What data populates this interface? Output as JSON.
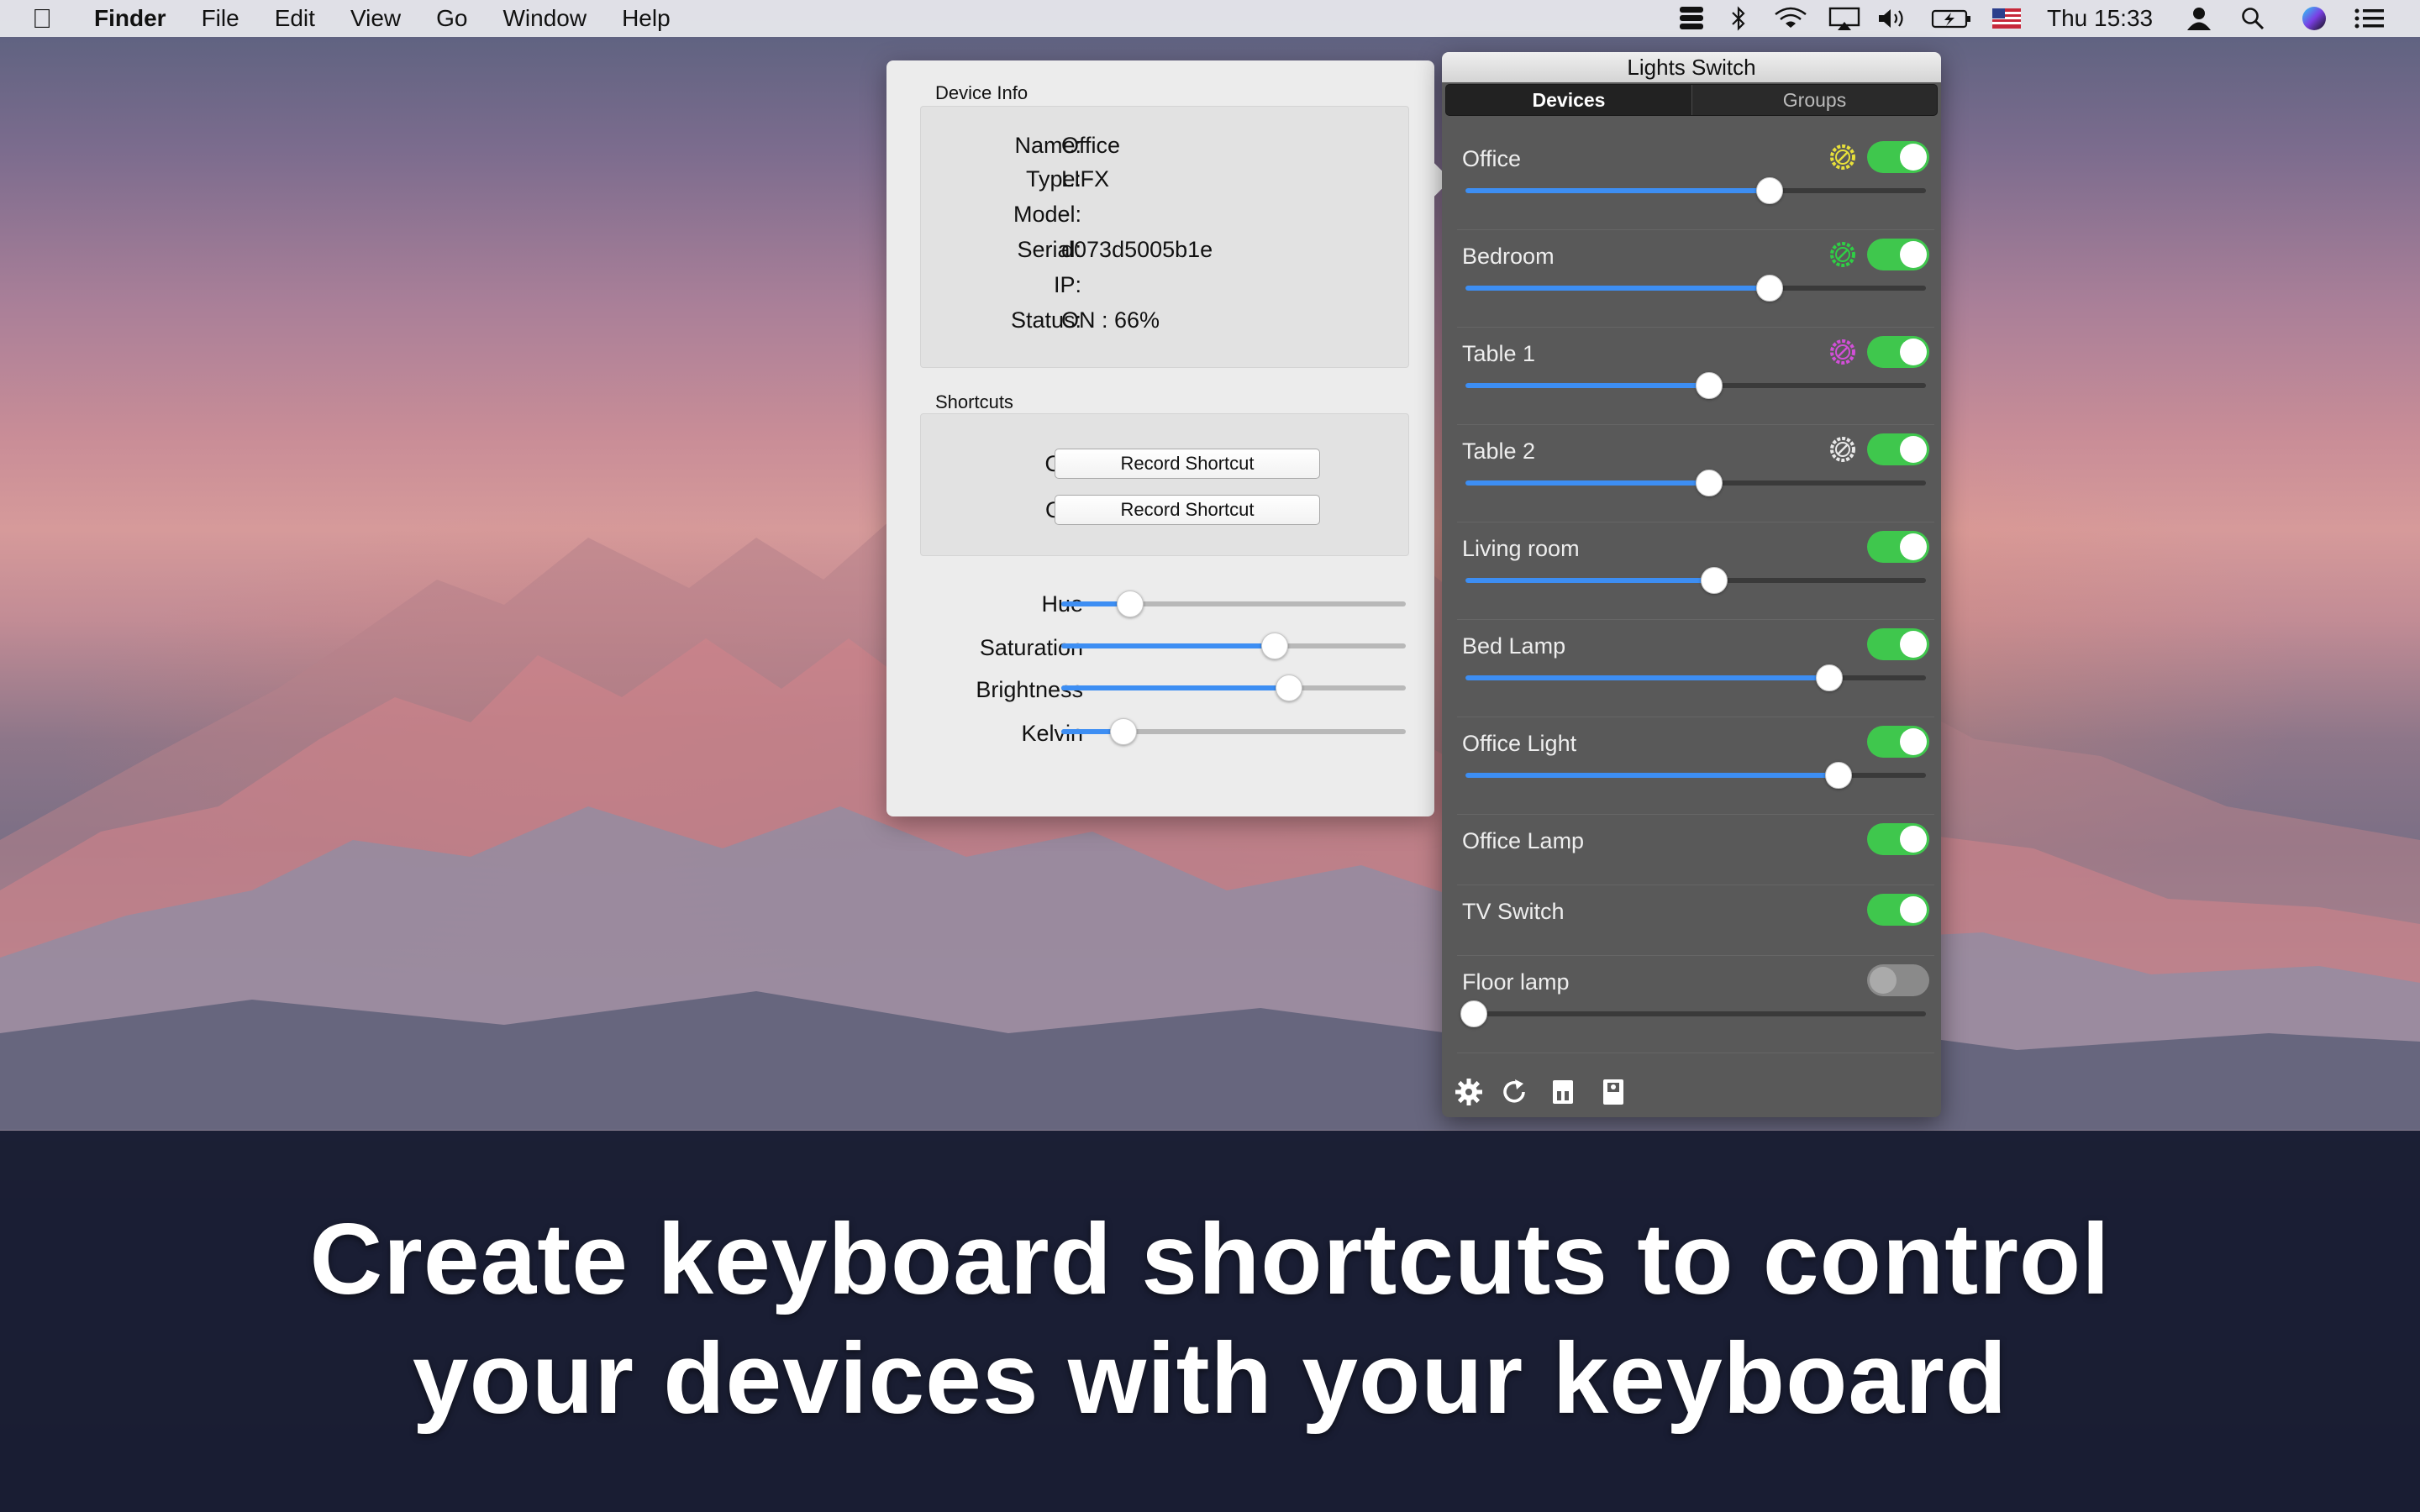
{
  "menubar": {
    "apple_icon": "apple-icon",
    "app_name": "Finder",
    "items": [
      "File",
      "Edit",
      "View",
      "Go",
      "Window",
      "Help"
    ],
    "clock": "Thu 15:33",
    "status_icons": [
      "lights-switch-icon",
      "bluetooth-icon",
      "wifi-icon",
      "airplay-icon",
      "volume-icon",
      "battery-icon",
      "flag-us-icon",
      "user-icon",
      "search-icon",
      "siri-icon",
      "notification-list-icon"
    ]
  },
  "device_info": {
    "title": "Device Info",
    "rows": [
      {
        "label": "Name:",
        "value": "Office"
      },
      {
        "label": "Type:",
        "value": "LIFX"
      },
      {
        "label": "Model:",
        "value": ""
      },
      {
        "label": "Serial:",
        "value": "d073d5005b1e"
      },
      {
        "label": "IP:",
        "value": ""
      },
      {
        "label": "Status:",
        "value": "ON : 66%"
      }
    ]
  },
  "shortcuts": {
    "title": "Shortcuts",
    "on_label": "On:",
    "off_label": "Off:",
    "on_button": "Record Shortcut",
    "off_button": "Record Shortcut"
  },
  "color_controls": [
    {
      "label": "Hue",
      "value": 0.2
    },
    {
      "label": "Saturation",
      "value": 0.62
    },
    {
      "label": "Brightness",
      "value": 0.66
    },
    {
      "label": "Kelvin",
      "value": 0.18
    }
  ],
  "panel": {
    "title": "Lights Switch",
    "tabs": [
      "Devices",
      "Groups"
    ],
    "active_tab": "Devices",
    "devices": [
      {
        "name": "Office",
        "on": true,
        "color": "#e8e03a",
        "level": 0.66,
        "has_slider": true
      },
      {
        "name": "Bedroom",
        "on": true,
        "color": "#2fcf45",
        "level": 0.66,
        "has_slider": true
      },
      {
        "name": "Table 1",
        "on": true,
        "color": "#d24fd8",
        "level": 0.53,
        "has_slider": true
      },
      {
        "name": "Table 2",
        "on": true,
        "color": "#e8e8e8",
        "level": 0.53,
        "has_slider": true
      },
      {
        "name": "Living room",
        "on": true,
        "color": "",
        "level": 0.54,
        "has_slider": true
      },
      {
        "name": "Bed Lamp",
        "on": true,
        "color": "",
        "level": 0.79,
        "has_slider": true
      },
      {
        "name": "Office Light",
        "on": true,
        "color": "",
        "level": 0.81,
        "has_slider": true
      },
      {
        "name": "Office Lamp",
        "on": true,
        "color": "",
        "level": null,
        "has_slider": false
      },
      {
        "name": "TV Switch",
        "on": true,
        "color": "",
        "level": null,
        "has_slider": false
      },
      {
        "name": "Floor lamp",
        "on": false,
        "color": "",
        "level": 0.0,
        "has_slider": true
      }
    ],
    "footer_icons": [
      "gear-icon",
      "refresh-icon",
      "scene-icon",
      "device-icon"
    ]
  },
  "caption": {
    "line1": "Create keyboard shortcuts to control",
    "line2": "your devices with your keyboard"
  },
  "colors": {
    "accent": "#3d8ef3",
    "toggle_on": "#3fc74d",
    "panel_bg": "#595959",
    "caption_bg": "#181c32"
  }
}
